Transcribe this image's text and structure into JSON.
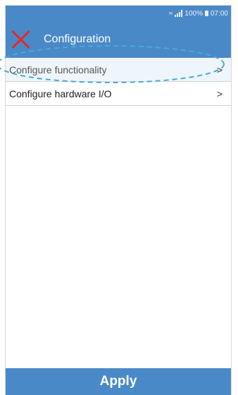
{
  "status_bar": {
    "battery": "100%",
    "time": "07:00"
  },
  "app_bar": {
    "title": "Configuration",
    "close_icon": "close-x-icon",
    "close_color": "#e02a2a"
  },
  "menu": {
    "items": [
      {
        "label": "Configure functionality",
        "chevron": ">",
        "highlighted": true
      },
      {
        "label": "Configure hardware I/O",
        "chevron": ">",
        "highlighted": false
      }
    ]
  },
  "footer": {
    "apply_label": "Apply"
  },
  "colors": {
    "primary": "#4a89c8",
    "highlight_ring": "#4aa8d8"
  }
}
